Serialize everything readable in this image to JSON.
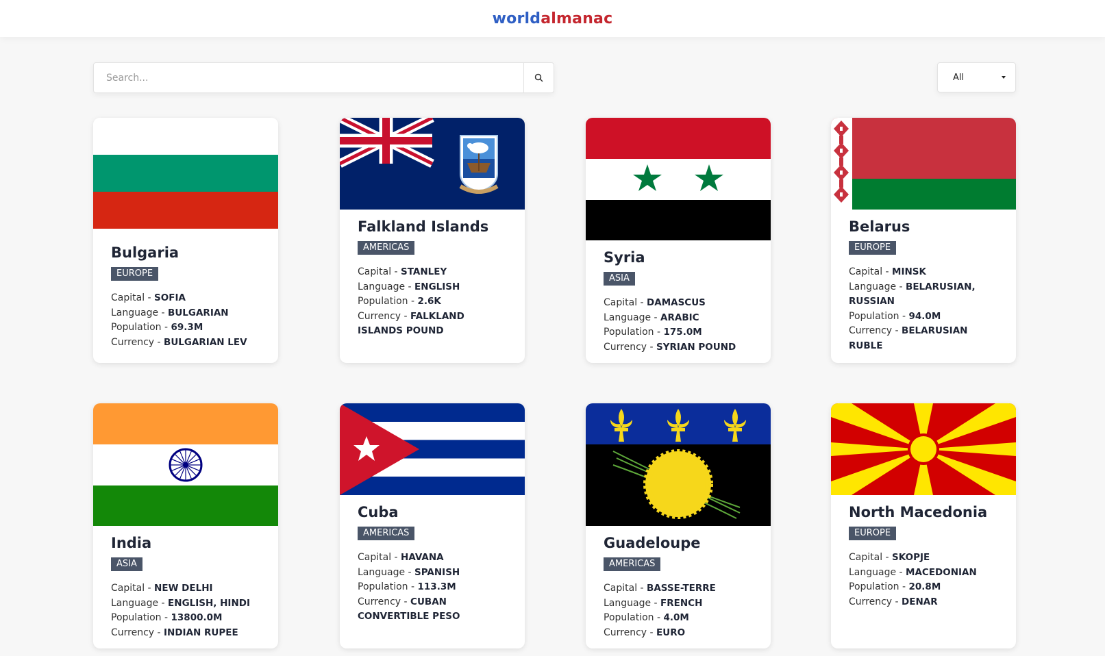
{
  "header": {
    "logo_part1": "world",
    "logo_part2": "almanac"
  },
  "search": {
    "placeholder": "Search..."
  },
  "filter": {
    "selected": "All"
  },
  "labels": {
    "capital": "Capital - ",
    "language": "Language - ",
    "population": "Population - ",
    "currency": "Currency - "
  },
  "countries": [
    {
      "name": "Bulgaria",
      "region": "EUROPE",
      "capital": "SOFIA",
      "language": "BULGARIAN",
      "population": "69.3M",
      "currency": "BULGARIAN LEV",
      "flag": "bulgaria-flag"
    },
    {
      "name": "Falkland Islands",
      "region": "AMERICAS",
      "capital": "STANLEY",
      "language": "ENGLISH",
      "population": "2.6K",
      "currency": "FALKLAND ISLANDS POUND",
      "flag": "falkland-islands-flag"
    },
    {
      "name": "Syria",
      "region": "ASIA",
      "capital": "DAMASCUS",
      "language": "ARABIC",
      "population": "175.0M",
      "currency": "SYRIAN POUND",
      "flag": "syria-flag"
    },
    {
      "name": "Belarus",
      "region": "EUROPE",
      "capital": "MINSK",
      "language": "BELARUSIAN, RUSSIAN",
      "population": "94.0M",
      "currency": "BELARUSIAN RUBLE",
      "flag": "belarus-flag"
    },
    {
      "name": "India",
      "region": "ASIA",
      "capital": "NEW DELHI",
      "language": "ENGLISH, HINDI",
      "population": "13800.0M",
      "currency": "INDIAN RUPEE",
      "flag": "india-flag"
    },
    {
      "name": "Cuba",
      "region": "AMERICAS",
      "capital": "HAVANA",
      "language": "SPANISH",
      "population": "113.3M",
      "currency": "CUBAN CONVERTIBLE PESO",
      "flag": "cuba-flag"
    },
    {
      "name": "Guadeloupe",
      "region": "AMERICAS",
      "capital": "BASSE-TERRE",
      "language": "FRENCH",
      "population": "4.0M",
      "currency": "EURO",
      "flag": "guadeloupe-flag"
    },
    {
      "name": "North Macedonia",
      "region": "EUROPE",
      "capital": "SKOPJE",
      "language": "MACEDONIAN",
      "population": "20.8M",
      "currency": "DENAR",
      "flag": "north-macedonia-flag"
    }
  ]
}
